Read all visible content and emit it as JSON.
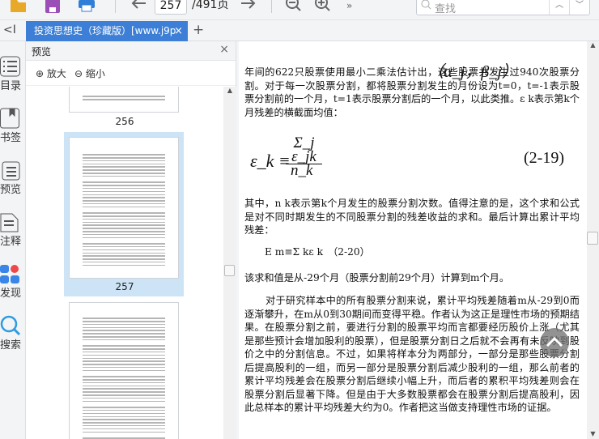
{
  "toolbar": {
    "page_current": "257",
    "page_total": "/491页",
    "search_placeholder": "查找",
    "more": "»"
  },
  "tab": {
    "title": "投资思想史（珍藏版）[www.j9p",
    "close": "×",
    "add": "+",
    "collapse": "<I"
  },
  "rail": [
    {
      "label": "目录"
    },
    {
      "label": "书签"
    },
    {
      "label": "预览"
    },
    {
      "label": "注释"
    },
    {
      "label": "发现"
    },
    {
      "label": "搜索"
    }
  ],
  "panel": {
    "title": "预览",
    "close": "×",
    "zoom_in": "放大",
    "zoom_out": "缩小",
    "pages": [
      "256",
      "257"
    ]
  },
  "doc": {
    "p1": "年间的622只股票使用最小二乘法估计出（α<sub>j</sub>，β<sub>j</sub>），这些股票共发生过940次股票分割。对于每一次股票分割，都将股票分割发生的月份设为t=0，t=-1表示股票分割前的一个月，t=1表示股票分割后的一个月，以此类推。ε <sub>k</sub>表示第k个月残差的横截面均值：",
    "p1_text": "年间的622只股票使用最小二乘法估计出",
    "p1_pair": "（α_j，β_j）",
    "p1_rest": "，这些股票共发生过940次股票分割。对于每一次股票分割，都将股票分割发生的月份设为t=0，t=-1表示股票分割前的一个月，t=1表示股票分割后的一个月，以此类推。ε k表示第k个月残差的横截面均值：",
    "eq1_lhs": "ε_k ≡",
    "eq1_num": "Σ_j ε_jk",
    "eq1_den": "n_k",
    "eq1_no": "(2-19)",
    "p2": "其中，n k表示第k个月发生的股票分割次数。值得注意的是，这个求和公式是对不同时期发生的不同股票分割的残差收益的求和。最后计算出累计平均残差：",
    "eq2": "E m≡Σ kε k　（2-20）",
    "p3": "该求和值是从-29个月（股票分割前29个月）计算到m个月。",
    "p4": "对于研究样本中的所有股票分割来说，累计平均残差随着m从-29到0而逐渐攀升，在m从0到30期间而变得平稳。作者认为这正是理性市场的预期结果。在股票分割之前，要进行分割的股票平均而言都要经历股价上涨（尤其是那些预计会增加股利的股票），但是股票分割日之后就不会再有未反映到股价之中的分割信息。不过，如果将样本分为两部分，一部分是那些股票分割后提高股利的一组，而另一部分是股票分割后减少股利的一组，那么前者的累计平均残差会在股票分割后继续小幅上升，而后者的累积平均残差则会在股票分割后显著下降。但是由于大多数股票都会在股票分割后提高股利，因此总样本的累计平均残差大约为0。作者把这当做支持理性市场的证据。"
  },
  "colors": {
    "accent": "#3d7fd6",
    "selection": "#cde4f7"
  }
}
